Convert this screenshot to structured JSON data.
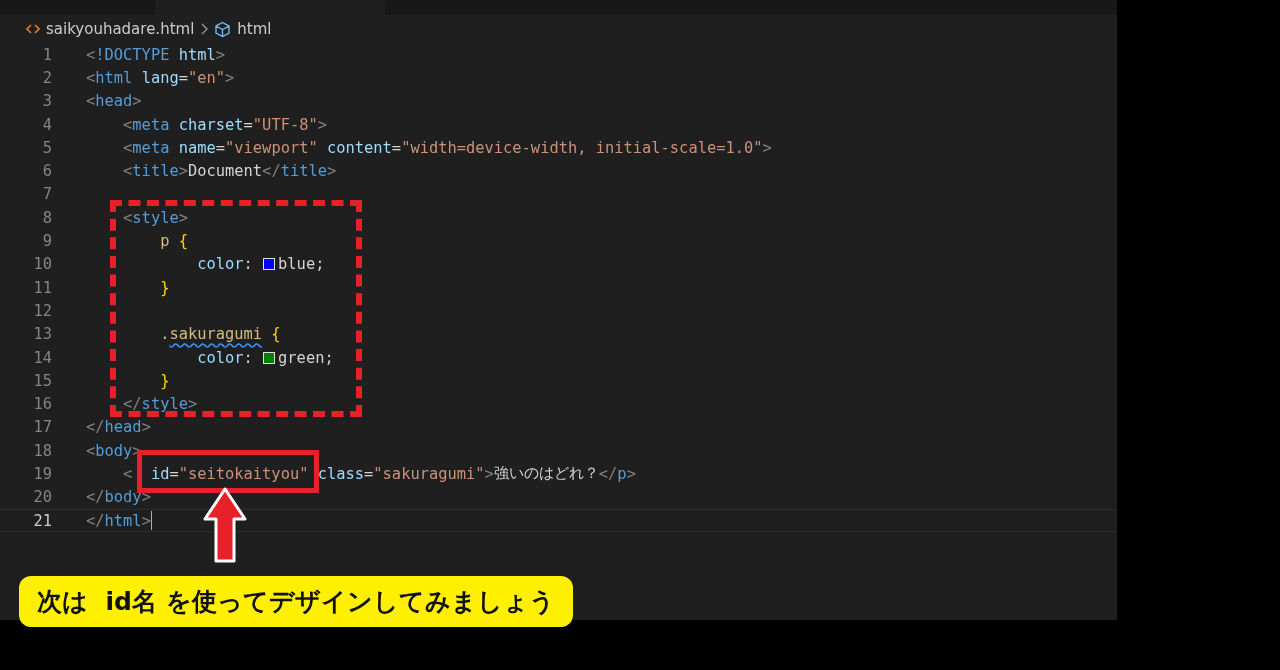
{
  "breadcrumb": {
    "file": "saikyouhadare.html",
    "symbol": "html"
  },
  "lines": [
    {
      "number": "1",
      "current": false,
      "tokens": [
        {
          "t": "<",
          "kind": "punct"
        },
        {
          "t": "!DOCTYPE",
          "kind": "tag"
        },
        {
          "t": " html",
          "kind": "attr"
        },
        {
          "t": ">",
          "kind": "punct"
        }
      ]
    },
    {
      "number": "2",
      "current": false,
      "tokens": [
        {
          "t": "<",
          "kind": "punct"
        },
        {
          "t": "html",
          "kind": "tag"
        },
        {
          "t": " lang",
          "kind": "attr"
        },
        {
          "t": "=",
          "kind": "text"
        },
        {
          "t": "\"en\"",
          "kind": "str"
        },
        {
          "t": ">",
          "kind": "punct"
        }
      ]
    },
    {
      "number": "3",
      "current": false,
      "tokens": [
        {
          "t": "<",
          "kind": "punct"
        },
        {
          "t": "head",
          "kind": "tag"
        },
        {
          "t": ">",
          "kind": "punct"
        }
      ]
    },
    {
      "number": "4",
      "current": false,
      "tokens": [
        {
          "t": "    <",
          "kind": "punct"
        },
        {
          "t": "meta",
          "kind": "tag"
        },
        {
          "t": " charset",
          "kind": "attr"
        },
        {
          "t": "=",
          "kind": "text"
        },
        {
          "t": "\"UTF-8\"",
          "kind": "str"
        },
        {
          "t": ">",
          "kind": "punct"
        }
      ]
    },
    {
      "number": "5",
      "current": false,
      "tokens": [
        {
          "t": "    <",
          "kind": "punct"
        },
        {
          "t": "meta",
          "kind": "tag"
        },
        {
          "t": " name",
          "kind": "attr"
        },
        {
          "t": "=",
          "kind": "text"
        },
        {
          "t": "\"viewport\"",
          "kind": "str"
        },
        {
          "t": " content",
          "kind": "attr"
        },
        {
          "t": "=",
          "kind": "text"
        },
        {
          "t": "\"width=device-width, initial-scale=1.0\"",
          "kind": "str"
        },
        {
          "t": ">",
          "kind": "punct"
        }
      ]
    },
    {
      "number": "6",
      "current": false,
      "tokens": [
        {
          "t": "    <",
          "kind": "punct"
        },
        {
          "t": "title",
          "kind": "tag"
        },
        {
          "t": ">",
          "kind": "punct"
        },
        {
          "t": "Document",
          "kind": "text"
        },
        {
          "t": "</",
          "kind": "punct"
        },
        {
          "t": "title",
          "kind": "tag"
        },
        {
          "t": ">",
          "kind": "punct"
        }
      ]
    },
    {
      "number": "7",
      "current": false
    },
    {
      "number": "8",
      "current": false,
      "tokens": [
        {
          "t": "    <",
          "kind": "punct"
        },
        {
          "t": "style",
          "kind": "tag"
        },
        {
          "t": ">",
          "kind": "punct"
        }
      ]
    },
    {
      "number": "9",
      "current": false,
      "tokens": [
        {
          "t": "        p",
          "kind": "selector"
        },
        {
          "t": " {",
          "kind": "brace"
        }
      ]
    },
    {
      "number": "10",
      "current": false,
      "tokens": [
        {
          "t": "            color",
          "kind": "attr"
        },
        {
          "t": ": ",
          "kind": "text"
        },
        {
          "kind": "swatch",
          "color": "#0000ff"
        },
        {
          "t": "blue;",
          "kind": "text"
        }
      ]
    },
    {
      "number": "11",
      "current": false,
      "tokens": [
        {
          "t": "        }",
          "kind": "brace"
        }
      ]
    },
    {
      "number": "12",
      "current": false
    },
    {
      "number": "13",
      "current": false,
      "tokens": [
        {
          "t": "        .",
          "kind": "selector"
        },
        {
          "t": "sakuragumi",
          "kind": "selector",
          "squiggle": true
        },
        {
          "t": " {",
          "kind": "brace"
        }
      ]
    },
    {
      "number": "14",
      "current": false,
      "tokens": [
        {
          "t": "            color",
          "kind": "attr"
        },
        {
          "t": ": ",
          "kind": "text"
        },
        {
          "kind": "swatch",
          "color": "#008000"
        },
        {
          "t": "green;",
          "kind": "text"
        }
      ]
    },
    {
      "number": "15",
      "current": false,
      "tokens": [
        {
          "t": "        }",
          "kind": "brace"
        }
      ]
    },
    {
      "number": "16",
      "current": false,
      "tokens": [
        {
          "t": "    </",
          "kind": "punct"
        },
        {
          "t": "style",
          "kind": "tag"
        },
        {
          "t": ">",
          "kind": "punct"
        }
      ]
    },
    {
      "number": "17",
      "current": false,
      "tokens": [
        {
          "t": "</",
          "kind": "punct"
        },
        {
          "t": "head",
          "kind": "tag"
        },
        {
          "t": ">",
          "kind": "punct"
        }
      ]
    },
    {
      "number": "18",
      "current": false,
      "tokens": [
        {
          "t": "<",
          "kind": "punct"
        },
        {
          "t": "body",
          "kind": "tag"
        },
        {
          "t": ">",
          "kind": "punct"
        }
      ]
    },
    {
      "number": "19",
      "current": false,
      "tokens": [
        {
          "t": "    <",
          "kind": "punct"
        },
        {
          "t": "  id",
          "kind": "attr"
        },
        {
          "t": "=",
          "kind": "text"
        },
        {
          "t": "\"seitokaityou\"",
          "kind": "str"
        },
        {
          "t": " class",
          "kind": "attr"
        },
        {
          "t": "=",
          "kind": "text"
        },
        {
          "t": "\"sakuragumi\"",
          "kind": "str"
        },
        {
          "t": ">",
          "kind": "punct"
        },
        {
          "t": "強いのはどれ？",
          "kind": "text"
        },
        {
          "t": "</",
          "kind": "punct"
        },
        {
          "t": "p",
          "kind": "tag"
        },
        {
          "t": ">",
          "kind": "punct"
        }
      ]
    },
    {
      "number": "20",
      "current": false,
      "tokens": [
        {
          "t": "</",
          "kind": "punct"
        },
        {
          "t": "body",
          "kind": "tag"
        },
        {
          "t": ">",
          "kind": "punct"
        }
      ]
    },
    {
      "number": "21",
      "current": true,
      "tokens": [
        {
          "t": "</",
          "kind": "punct"
        },
        {
          "t": "html",
          "kind": "tag"
        },
        {
          "t": ">",
          "kind": "punct"
        }
      ]
    }
  ],
  "callout": {
    "text": "次は  id名 を使ってデザインしてみましょう"
  }
}
